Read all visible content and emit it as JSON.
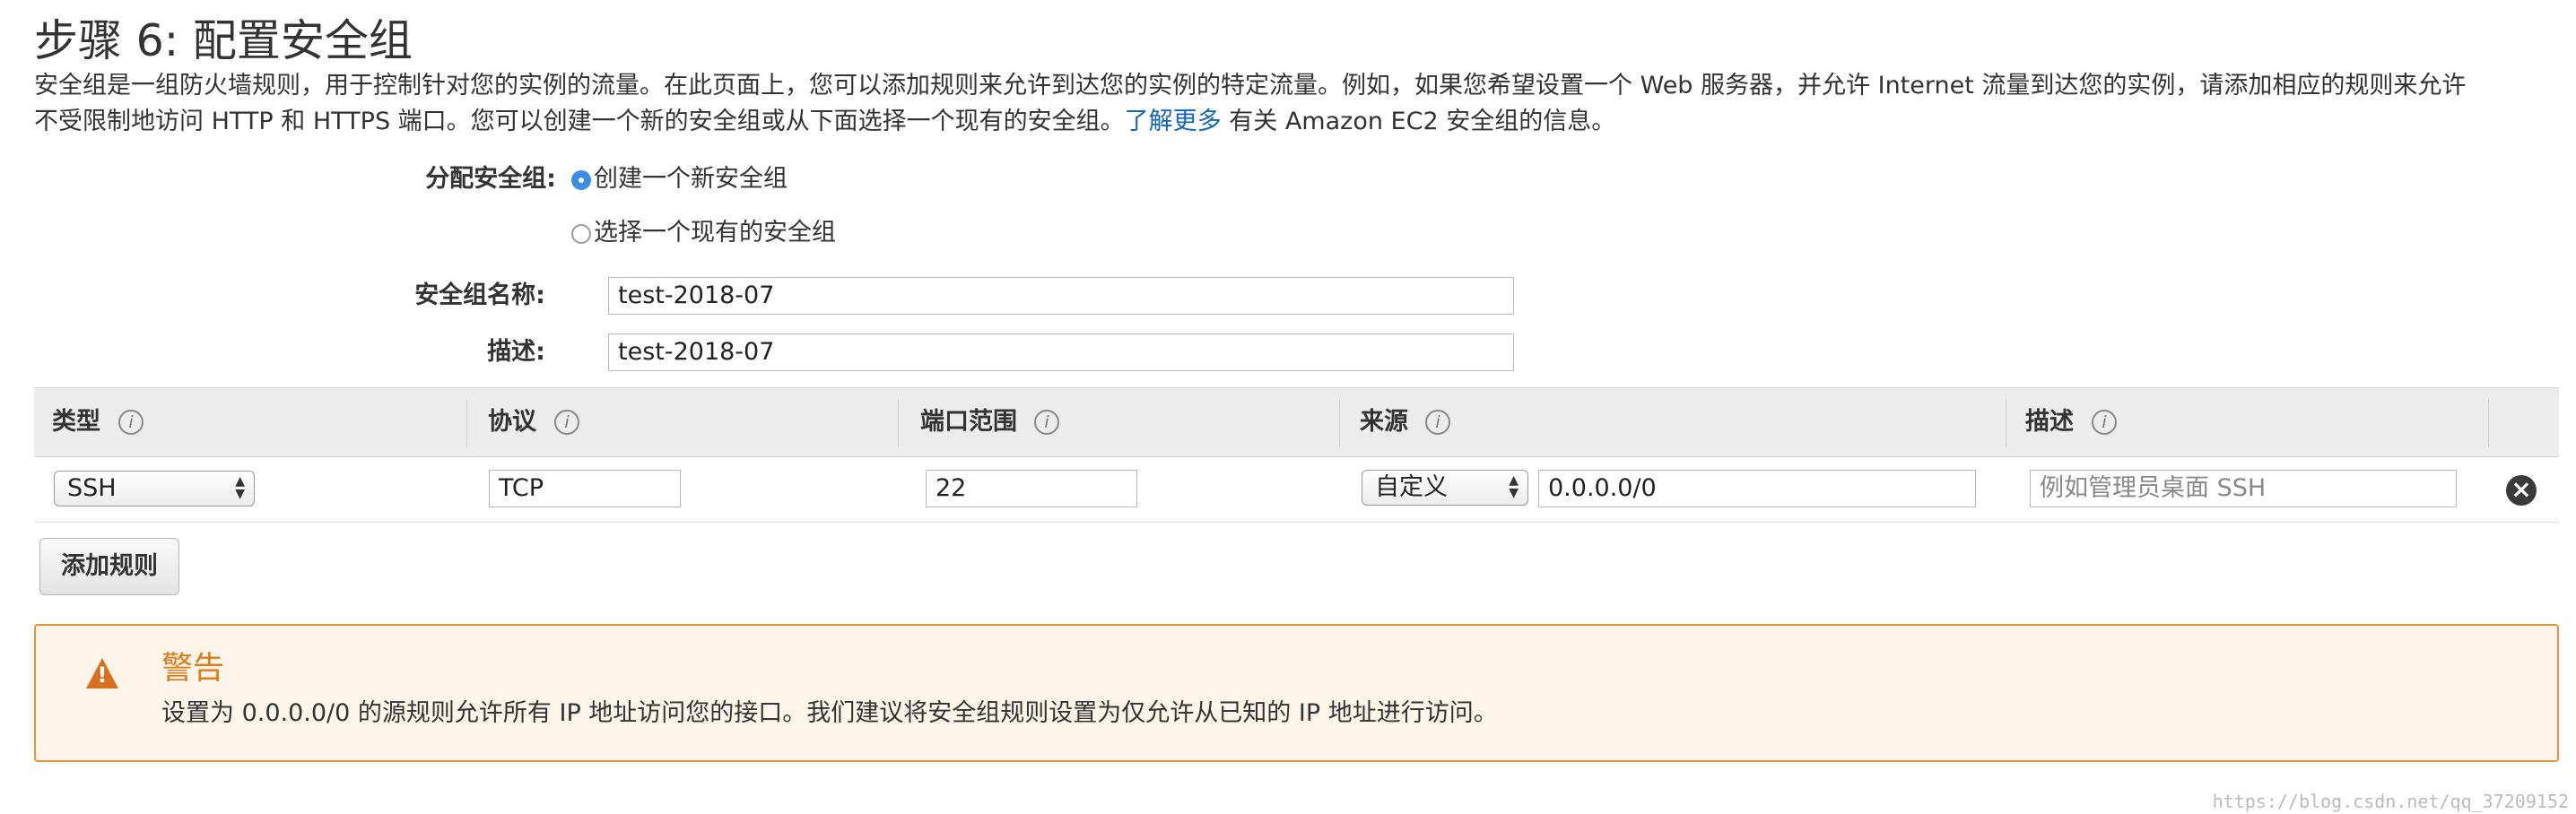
{
  "page": {
    "title": "步骤 6: 配置安全组",
    "description_line1": "安全组是一组防火墙规则，用于控制针对您的实例的流量。在此页面上，您可以添加规则来允许到达您的实例的特定流量。例如，如果您希望设置一个 Web 服务器，并允许 Internet 流量到达您的实例，请添加相应的规则来允许",
    "description_line2_prefix": "不受限制地访问 HTTP 和 HTTPS 端口。您可以创建一个新的安全组或从下面选择一个现有的安全组。",
    "learn_more_link": "了解更多",
    "description_line2_suffix": " 有关 Amazon EC2 安全组的信息。"
  },
  "form": {
    "assign_label": "分配安全组:",
    "option_new": "创建一个新安全组",
    "option_existing": "选择一个现有的安全组",
    "selected_option": "option_new",
    "name_label": "安全组名称:",
    "name_value": "test-2018-07",
    "desc_label": "描述:",
    "desc_value": "test-2018-07"
  },
  "table": {
    "columns": [
      "类型",
      "协议",
      "端口范围",
      "来源",
      "描述"
    ],
    "info_glyph": "i",
    "rows": [
      {
        "type": "SSH",
        "protocol": "TCP",
        "port_range": "22",
        "source_mode": "自定义",
        "source_value": "0.0.0.0/0",
        "description_placeholder": "例如管理员桌面 SSH"
      }
    ]
  },
  "add_rule_label": "添加规则",
  "warning": {
    "title": "警告",
    "text": "设置为 0.0.0.0/0 的源规则允许所有 IP 地址访问您的接口。我们建议将安全组规则设置为仅允许从已知的 IP 地址进行访问。",
    "icon": "warning-triangle-icon",
    "color": "#e07b18"
  },
  "watermark": "https://blog.csdn.net/qq_37209152",
  "icons": {
    "select_arrows": "▲▼",
    "close": "×",
    "warning": "!"
  }
}
